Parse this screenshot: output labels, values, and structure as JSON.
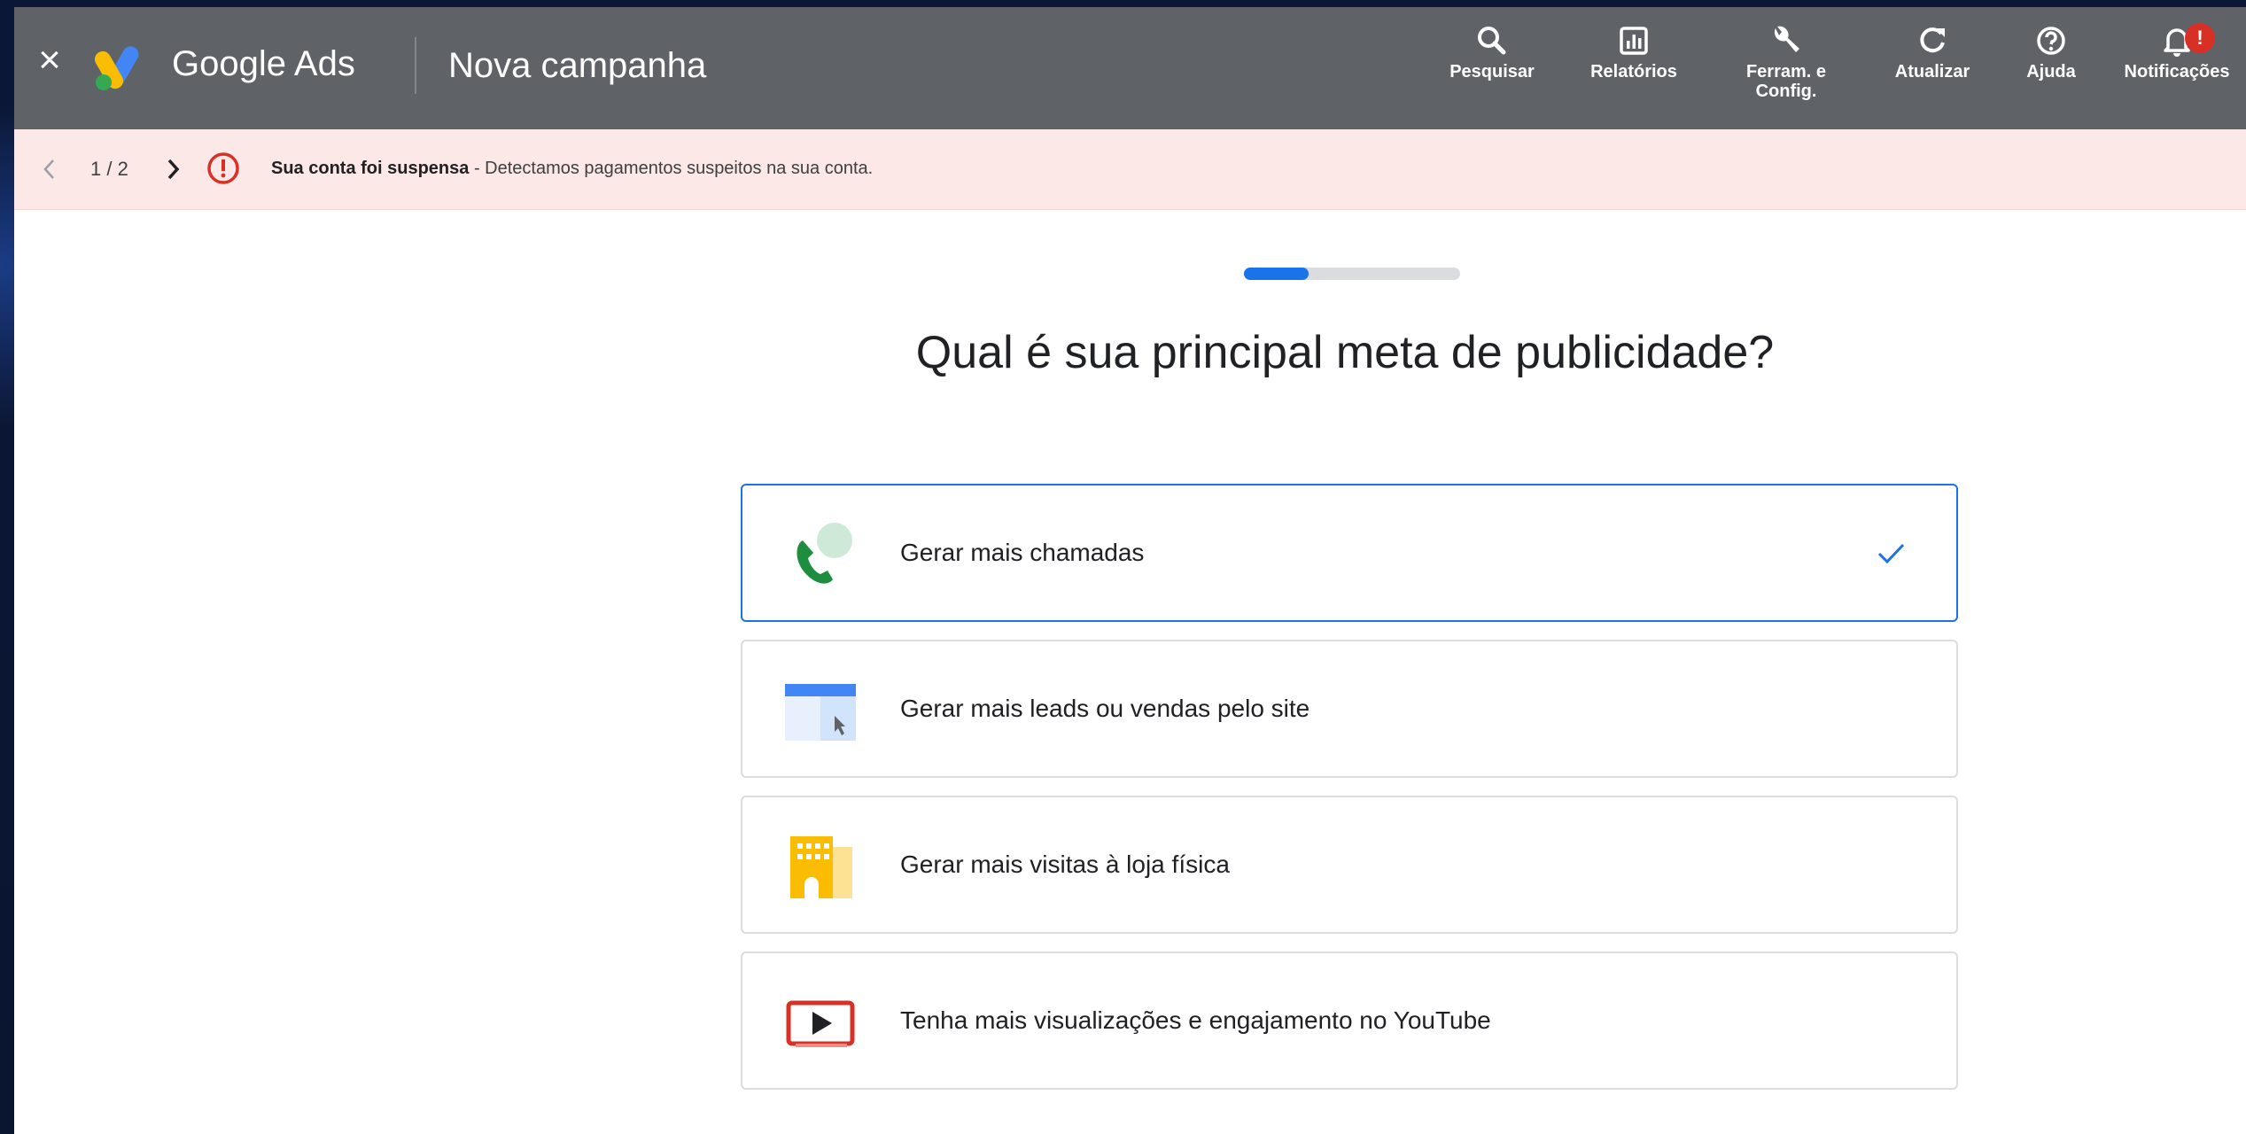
{
  "topbar": {
    "close_icon": "close-icon",
    "product_name": "Google Ads",
    "page_title": "Nova campanha",
    "tools": [
      {
        "icon": "search-icon",
        "label": "Pesquisar"
      },
      {
        "icon": "reports-icon",
        "label": "Relatórios"
      },
      {
        "icon": "wrench-icon",
        "label": "Ferram. e\nConfig."
      },
      {
        "icon": "refresh-icon",
        "label": "Atualizar"
      },
      {
        "icon": "help-icon",
        "label": "Ajuda"
      },
      {
        "icon": "bell-icon",
        "label": "Notificações",
        "badge": "!"
      }
    ]
  },
  "alert": {
    "pagination": "1 / 2",
    "title": "Sua conta foi suspensa",
    "message": " - Detectamos pagamentos suspeitos na sua conta."
  },
  "progress": {
    "fraction": 0.3
  },
  "main": {
    "question": "Qual é sua principal meta de publicidade?",
    "goals": [
      {
        "icon": "phone-call-icon",
        "label": "Gerar mais chamadas",
        "selected": true
      },
      {
        "icon": "website-icon",
        "label": "Gerar mais leads ou vendas pelo site",
        "selected": false
      },
      {
        "icon": "store-icon",
        "label": "Gerar mais visitas à loja física",
        "selected": false
      },
      {
        "icon": "youtube-play-icon",
        "label": "Tenha mais visualizações e engajamento no YouTube",
        "selected": false
      }
    ]
  },
  "colors": {
    "topbar": "#5f6368",
    "alert_bg": "#fce8e6",
    "accent": "#1a73e8",
    "error": "#d93025"
  }
}
